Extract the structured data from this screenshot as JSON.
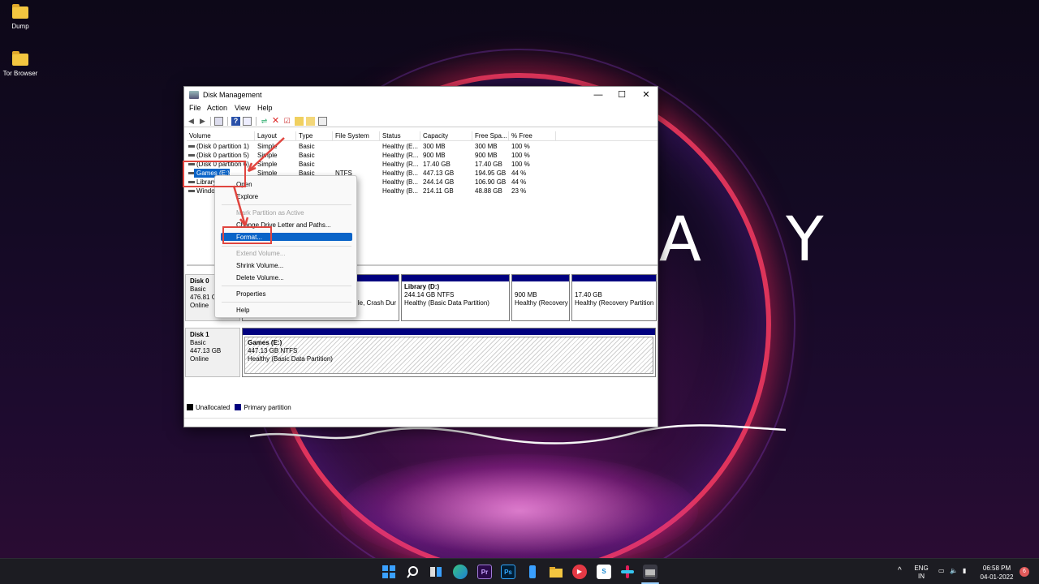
{
  "desktop": {
    "icons": [
      {
        "label": "Dump",
        "icon": "folder-icon"
      },
      {
        "label": "Tor Browser",
        "icon": "folder-icon"
      }
    ],
    "wallpaper_text": "A Y"
  },
  "window": {
    "title": "Disk Management",
    "controls": {
      "minimize": "—",
      "maximize": "☐",
      "close": "✕"
    },
    "menu": [
      "File",
      "Action",
      "View",
      "Help"
    ]
  },
  "volume_list": {
    "columns": [
      "Volume",
      "Layout",
      "Type",
      "File System",
      "Status",
      "Capacity",
      "Free Spa...",
      "% Free"
    ],
    "rows": [
      {
        "volume": "(Disk 0 partition 1)",
        "layout": "Simple",
        "type": "Basic",
        "fs": "",
        "status": "Healthy (E...",
        "capacity": "300 MB",
        "free": "300 MB",
        "pct": "100 %"
      },
      {
        "volume": "(Disk 0 partition 5)",
        "layout": "Simple",
        "type": "Basic",
        "fs": "",
        "status": "Healthy (R...",
        "capacity": "900 MB",
        "free": "900 MB",
        "pct": "100 %"
      },
      {
        "volume": "(Disk 0 partition 6)",
        "layout": "Simple",
        "type": "Basic",
        "fs": "",
        "status": "Healthy (R...",
        "capacity": "17.40 GB",
        "free": "17.40 GB",
        "pct": "100 %"
      },
      {
        "volume": "Games (E:)",
        "layout": "Simple",
        "type": "Basic",
        "fs": "NTFS",
        "status": "Healthy (B...",
        "capacity": "447.13 GB",
        "free": "194.95 GB",
        "pct": "44 %"
      },
      {
        "volume": "Library",
        "layout": "",
        "type": "",
        "fs": "",
        "status": "Healthy (B...",
        "capacity": "244.14 GB",
        "free": "106.90 GB",
        "pct": "44 %"
      },
      {
        "volume": "Window",
        "layout": "",
        "type": "",
        "fs": "",
        "status": "Healthy (B...",
        "capacity": "214.11 GB",
        "free": "48.88 GB",
        "pct": "23 %"
      }
    ]
  },
  "context_menu": {
    "open": "Open",
    "explore": "Explore",
    "mark_active": "Mark Partition as Active",
    "change_letter": "Change Drive Letter and Paths...",
    "format": "Format...",
    "extend": "Extend Volume...",
    "shrink": "Shrink Volume...",
    "delete": "Delete Volume...",
    "properties": "Properties",
    "help": "Help"
  },
  "disks": {
    "disk0": {
      "name": "Disk 0",
      "type": "Basic",
      "size": "476.81 GB",
      "state": "Online",
      "partial_text": "le, Crash Dur",
      "partitions": [
        {
          "name": "Library  (D:)",
          "size": "244.14 GB NTFS",
          "status": "Healthy (Basic Data Partition)"
        },
        {
          "size": "900 MB",
          "status": "Healthy (Recovery"
        },
        {
          "size": "17.40 GB",
          "status": "Healthy (Recovery Partition"
        }
      ]
    },
    "disk1": {
      "name": "Disk 1",
      "type": "Basic",
      "size": "447.13 GB",
      "state": "Online",
      "partition": {
        "name": "Games  (E:)",
        "size": "447.13 GB NTFS",
        "status": "Healthy (Basic Data Partition)"
      }
    }
  },
  "legend": {
    "unallocated": "Unallocated",
    "primary": "Primary partition"
  },
  "colors": {
    "primary_partition": "#00007f",
    "selection": "#0a64c8",
    "annotation": "#e0453f"
  },
  "taskbar": {
    "icons": [
      "windows-start-icon",
      "search-icon",
      "task-view-icon",
      "edge-icon",
      "premiere-icon",
      "photoshop-icon",
      "phone-icon",
      "file-explorer-icon",
      "media-player-icon",
      "sway-icon",
      "slack-icon",
      "disk-management-icon"
    ],
    "premiere_label": "Pr",
    "photoshop_label": "Ps",
    "sway_label": "S",
    "language": "ENG",
    "region": "IN",
    "time": "06:58 PM",
    "date": "04-01-2022",
    "notification_count": "6"
  }
}
